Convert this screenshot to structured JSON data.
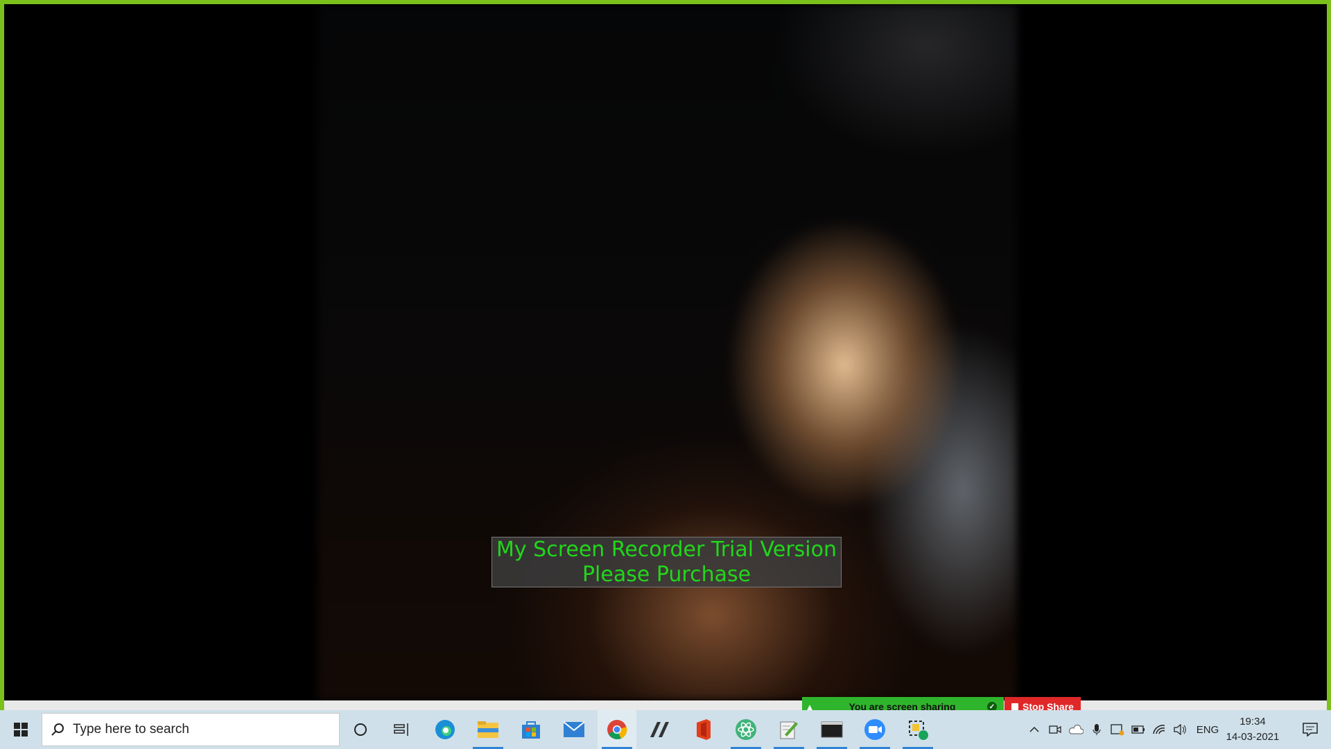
{
  "watermark": {
    "line1": "My Screen Recorder Trial Version",
    "line2": "Please Purchase"
  },
  "share_banner": {
    "text": "You are screen sharing",
    "stop_label": "Stop Share"
  },
  "taskbar": {
    "search_placeholder": "Type here to search",
    "pinned_icons": [
      "cortana-icon",
      "task-view-icon",
      "edge-icon",
      "file-explorer-icon",
      "store-icon",
      "mail-icon",
      "chrome-icon",
      "app-slash-icon",
      "office-icon",
      "atom-icon",
      "notepad-icon",
      "terminal-icon",
      "zoom-icon",
      "snip-icon"
    ],
    "tray_icons": [
      "chevron-up-icon",
      "meet-now-icon",
      "onedrive-icon",
      "microphone-icon",
      "security-icon",
      "battery-icon",
      "wifi-icon",
      "volume-icon"
    ],
    "language": "ENG",
    "time": "19:34",
    "date": "14-03-2021"
  },
  "colors": {
    "share_border": "#7ac11c",
    "share_banner": "#2fb52c",
    "stop_share": "#e02828",
    "watermark_text": "#21d71b",
    "taskbar_bg": "#cfe0ea"
  }
}
